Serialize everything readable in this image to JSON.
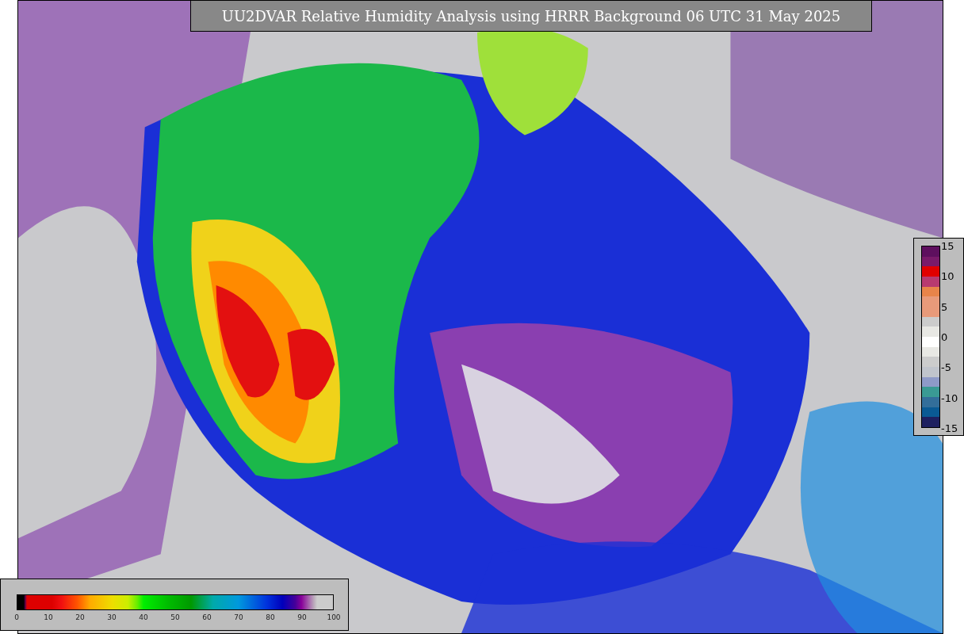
{
  "title": "UU2DVAR Relative Humidity Analysis using HRRR Background 06 UTC 31 May 2025",
  "humidity_legend": {
    "ticks": [
      "0",
      "10",
      "20",
      "30",
      "40",
      "50",
      "60",
      "70",
      "80",
      "90",
      "100"
    ]
  },
  "increment_legend": {
    "ticks": [
      "15",
      "10",
      "5",
      "0",
      "-5",
      "-10",
      "-15"
    ]
  }
}
